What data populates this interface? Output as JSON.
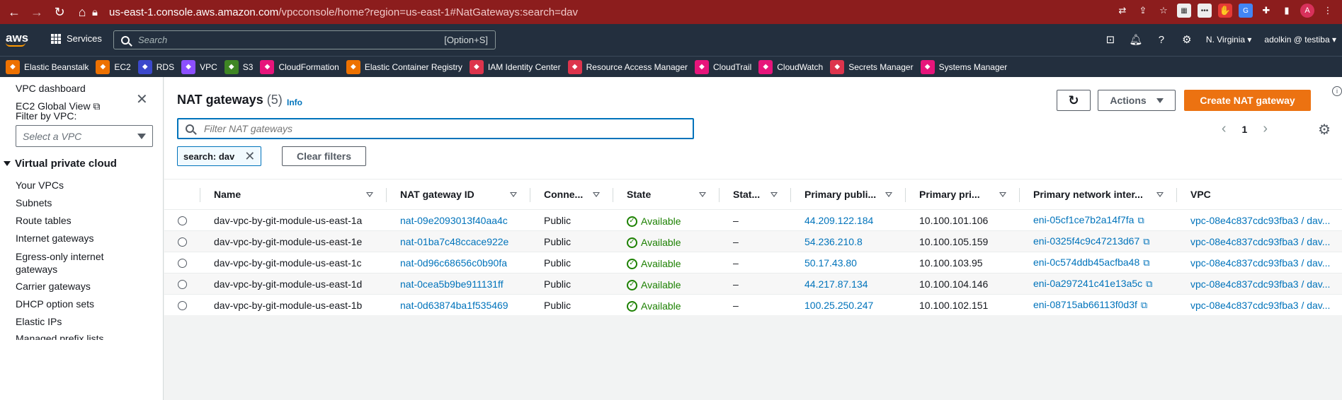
{
  "browser": {
    "url_host": "us-east-1.console.aws.amazon.com",
    "url_path": "/vpcconsole/home?region=us-east-1#NatGateways:search=dav",
    "avatar_letter": "A"
  },
  "aws_header": {
    "logo": "aws",
    "services_label": "Services",
    "search_placeholder": "Search",
    "search_hint": "[Option+S]",
    "region": "N. Virginia",
    "account": "adolkin @ testiba"
  },
  "favorites": [
    {
      "label": "Elastic Beanstalk",
      "color": "#ed7100",
      "icon": "beanstalk-icon"
    },
    {
      "label": "EC2",
      "color": "#ed7100",
      "icon": "ec2-icon"
    },
    {
      "label": "RDS",
      "color": "#3b48cc",
      "icon": "rds-icon"
    },
    {
      "label": "VPC",
      "color": "#8c4fff",
      "icon": "vpc-icon"
    },
    {
      "label": "S3",
      "color": "#3f8624",
      "icon": "s3-icon"
    },
    {
      "label": "CloudFormation",
      "color": "#e7157b",
      "icon": "cloudformation-icon"
    },
    {
      "label": "Elastic Container Registry",
      "color": "#ed7100",
      "icon": "ecr-icon"
    },
    {
      "label": "IAM Identity Center",
      "color": "#dd344c",
      "icon": "iam-icon"
    },
    {
      "label": "Resource Access Manager",
      "color": "#dd344c",
      "icon": "ram-icon"
    },
    {
      "label": "CloudTrail",
      "color": "#e7157b",
      "icon": "cloudtrail-icon"
    },
    {
      "label": "CloudWatch",
      "color": "#e7157b",
      "icon": "cloudwatch-icon"
    },
    {
      "label": "Secrets Manager",
      "color": "#dd344c",
      "icon": "secrets-icon"
    },
    {
      "label": "Systems Manager",
      "color": "#e7157b",
      "icon": "ssm-icon"
    }
  ],
  "sidebar": {
    "dashboard": "VPC dashboard",
    "global_view": "EC2 Global View",
    "filter_label": "Filter by VPC:",
    "filter_placeholder": "Select a VPC",
    "section_title": "Virtual private cloud",
    "items": [
      {
        "label": "Your VPCs"
      },
      {
        "label": "Subnets"
      },
      {
        "label": "Route tables"
      },
      {
        "label": "Internet gateways"
      },
      {
        "label": "Egress-only internet gateways"
      },
      {
        "label": "Carrier gateways"
      },
      {
        "label": "DHCP option sets"
      },
      {
        "label": "Elastic IPs"
      },
      {
        "label": "Managed prefix lists"
      }
    ]
  },
  "main": {
    "title": "NAT gateways",
    "count": "(5)",
    "info": "Info",
    "actions_label": "Actions",
    "create_label": "Create NAT gateway",
    "filter_placeholder": "Filter NAT gateways",
    "page_number": "1",
    "token_label": "search: dav",
    "clear_filters": "Clear filters"
  },
  "table": {
    "columns": [
      "Name",
      "NAT gateway ID",
      "Conne...",
      "State",
      "Stat...",
      "Primary publi...",
      "Primary pri...",
      "Primary network inter...",
      "VPC"
    ],
    "rows": [
      {
        "name": "dav-vpc-by-git-module-us-east-1a",
        "id": "nat-09e2093013f40aa4c",
        "connectivity": "Public",
        "state": "Available",
        "state_message": "–",
        "public_ip": "44.209.122.184",
        "private_ip": "10.100.101.106",
        "eni": "eni-05cf1ce7b2a14f7fa",
        "vpc": "vpc-08e4c837cdc93fba3 / dav..."
      },
      {
        "name": "dav-vpc-by-git-module-us-east-1e",
        "id": "nat-01ba7c48ccace922e",
        "connectivity": "Public",
        "state": "Available",
        "state_message": "–",
        "public_ip": "54.236.210.8",
        "private_ip": "10.100.105.159",
        "eni": "eni-0325f4c9c47213d67",
        "vpc": "vpc-08e4c837cdc93fba3 / dav..."
      },
      {
        "name": "dav-vpc-by-git-module-us-east-1c",
        "id": "nat-0d96c68656c0b90fa",
        "connectivity": "Public",
        "state": "Available",
        "state_message": "–",
        "public_ip": "50.17.43.80",
        "private_ip": "10.100.103.95",
        "eni": "eni-0c574ddb45acfba48",
        "vpc": "vpc-08e4c837cdc93fba3 / dav..."
      },
      {
        "name": "dav-vpc-by-git-module-us-east-1d",
        "id": "nat-0cea5b9be911131ff",
        "connectivity": "Public",
        "state": "Available",
        "state_message": "–",
        "public_ip": "44.217.87.134",
        "private_ip": "10.100.104.146",
        "eni": "eni-0a297241c41e13a5c",
        "vpc": "vpc-08e4c837cdc93fba3 / dav..."
      },
      {
        "name": "dav-vpc-by-git-module-us-east-1b",
        "id": "nat-0d63874ba1f535469",
        "connectivity": "Public",
        "state": "Available",
        "state_message": "–",
        "public_ip": "100.25.250.247",
        "private_ip": "10.100.102.151",
        "eni": "eni-08715ab66113f0d3f",
        "vpc": "vpc-08e4c837cdc93fba3 / dav..."
      }
    ]
  },
  "colors": {
    "browser_bar": "#8c1d1d",
    "aws_header": "#232f3e",
    "primary_button": "#ec7211",
    "link": "#0073bb",
    "available": "#1d8102"
  }
}
